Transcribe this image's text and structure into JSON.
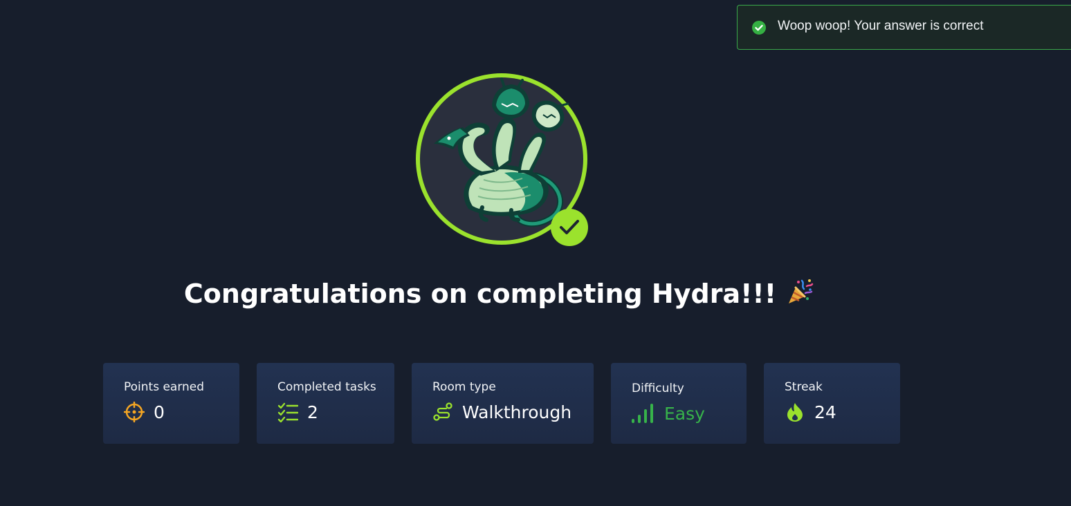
{
  "toast": {
    "message": "Woop woop! Your answer is correct",
    "icon": "check-circle-icon",
    "color": "#3aa84a"
  },
  "badge": {
    "room": "Hydra",
    "image": "hydra-illustration",
    "completed": true,
    "ring_color": "#9be22d"
  },
  "title": {
    "text": "Congratulations on completing Hydra!!!",
    "emoji": "party-popper-icon"
  },
  "stats": {
    "points": {
      "label": "Points earned",
      "value": "0",
      "icon": "crosshair-icon",
      "color": "#f5a623"
    },
    "tasks": {
      "label": "Completed tasks",
      "value": "2",
      "icon": "checklist-icon",
      "color": "#9be22d"
    },
    "room_type": {
      "label": "Room type",
      "value": "Walkthrough",
      "icon": "route-icon",
      "color": "#9be22d"
    },
    "difficulty": {
      "label": "Difficulty",
      "value": "Easy",
      "icon": "signal-bars-icon",
      "color": "#37b34a"
    },
    "streak": {
      "label": "Streak",
      "value": "24",
      "icon": "flame-icon",
      "color": "#9be22d"
    }
  }
}
